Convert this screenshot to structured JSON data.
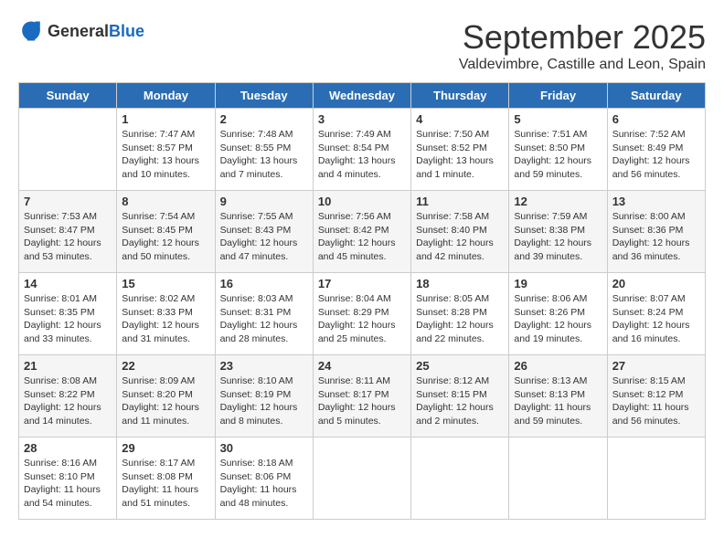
{
  "logo": {
    "general": "General",
    "blue": "Blue"
  },
  "title": "September 2025",
  "subtitle": "Valdevimbre, Castille and Leon, Spain",
  "headers": [
    "Sunday",
    "Monday",
    "Tuesday",
    "Wednesday",
    "Thursday",
    "Friday",
    "Saturday"
  ],
  "weeks": [
    [
      {
        "day": "",
        "info": ""
      },
      {
        "day": "1",
        "info": "Sunrise: 7:47 AM\nSunset: 8:57 PM\nDaylight: 13 hours\nand 10 minutes."
      },
      {
        "day": "2",
        "info": "Sunrise: 7:48 AM\nSunset: 8:55 PM\nDaylight: 13 hours\nand 7 minutes."
      },
      {
        "day": "3",
        "info": "Sunrise: 7:49 AM\nSunset: 8:54 PM\nDaylight: 13 hours\nand 4 minutes."
      },
      {
        "day": "4",
        "info": "Sunrise: 7:50 AM\nSunset: 8:52 PM\nDaylight: 13 hours\nand 1 minute."
      },
      {
        "day": "5",
        "info": "Sunrise: 7:51 AM\nSunset: 8:50 PM\nDaylight: 12 hours\nand 59 minutes."
      },
      {
        "day": "6",
        "info": "Sunrise: 7:52 AM\nSunset: 8:49 PM\nDaylight: 12 hours\nand 56 minutes."
      }
    ],
    [
      {
        "day": "7",
        "info": "Sunrise: 7:53 AM\nSunset: 8:47 PM\nDaylight: 12 hours\nand 53 minutes."
      },
      {
        "day": "8",
        "info": "Sunrise: 7:54 AM\nSunset: 8:45 PM\nDaylight: 12 hours\nand 50 minutes."
      },
      {
        "day": "9",
        "info": "Sunrise: 7:55 AM\nSunset: 8:43 PM\nDaylight: 12 hours\nand 47 minutes."
      },
      {
        "day": "10",
        "info": "Sunrise: 7:56 AM\nSunset: 8:42 PM\nDaylight: 12 hours\nand 45 minutes."
      },
      {
        "day": "11",
        "info": "Sunrise: 7:58 AM\nSunset: 8:40 PM\nDaylight: 12 hours\nand 42 minutes."
      },
      {
        "day": "12",
        "info": "Sunrise: 7:59 AM\nSunset: 8:38 PM\nDaylight: 12 hours\nand 39 minutes."
      },
      {
        "day": "13",
        "info": "Sunrise: 8:00 AM\nSunset: 8:36 PM\nDaylight: 12 hours\nand 36 minutes."
      }
    ],
    [
      {
        "day": "14",
        "info": "Sunrise: 8:01 AM\nSunset: 8:35 PM\nDaylight: 12 hours\nand 33 minutes."
      },
      {
        "day": "15",
        "info": "Sunrise: 8:02 AM\nSunset: 8:33 PM\nDaylight: 12 hours\nand 31 minutes."
      },
      {
        "day": "16",
        "info": "Sunrise: 8:03 AM\nSunset: 8:31 PM\nDaylight: 12 hours\nand 28 minutes."
      },
      {
        "day": "17",
        "info": "Sunrise: 8:04 AM\nSunset: 8:29 PM\nDaylight: 12 hours\nand 25 minutes."
      },
      {
        "day": "18",
        "info": "Sunrise: 8:05 AM\nSunset: 8:28 PM\nDaylight: 12 hours\nand 22 minutes."
      },
      {
        "day": "19",
        "info": "Sunrise: 8:06 AM\nSunset: 8:26 PM\nDaylight: 12 hours\nand 19 minutes."
      },
      {
        "day": "20",
        "info": "Sunrise: 8:07 AM\nSunset: 8:24 PM\nDaylight: 12 hours\nand 16 minutes."
      }
    ],
    [
      {
        "day": "21",
        "info": "Sunrise: 8:08 AM\nSunset: 8:22 PM\nDaylight: 12 hours\nand 14 minutes."
      },
      {
        "day": "22",
        "info": "Sunrise: 8:09 AM\nSunset: 8:20 PM\nDaylight: 12 hours\nand 11 minutes."
      },
      {
        "day": "23",
        "info": "Sunrise: 8:10 AM\nSunset: 8:19 PM\nDaylight: 12 hours\nand 8 minutes."
      },
      {
        "day": "24",
        "info": "Sunrise: 8:11 AM\nSunset: 8:17 PM\nDaylight: 12 hours\nand 5 minutes."
      },
      {
        "day": "25",
        "info": "Sunrise: 8:12 AM\nSunset: 8:15 PM\nDaylight: 12 hours\nand 2 minutes."
      },
      {
        "day": "26",
        "info": "Sunrise: 8:13 AM\nSunset: 8:13 PM\nDaylight: 11 hours\nand 59 minutes."
      },
      {
        "day": "27",
        "info": "Sunrise: 8:15 AM\nSunset: 8:12 PM\nDaylight: 11 hours\nand 56 minutes."
      }
    ],
    [
      {
        "day": "28",
        "info": "Sunrise: 8:16 AM\nSunset: 8:10 PM\nDaylight: 11 hours\nand 54 minutes."
      },
      {
        "day": "29",
        "info": "Sunrise: 8:17 AM\nSunset: 8:08 PM\nDaylight: 11 hours\nand 51 minutes."
      },
      {
        "day": "30",
        "info": "Sunrise: 8:18 AM\nSunset: 8:06 PM\nDaylight: 11 hours\nand 48 minutes."
      },
      {
        "day": "",
        "info": ""
      },
      {
        "day": "",
        "info": ""
      },
      {
        "day": "",
        "info": ""
      },
      {
        "day": "",
        "info": ""
      }
    ]
  ]
}
